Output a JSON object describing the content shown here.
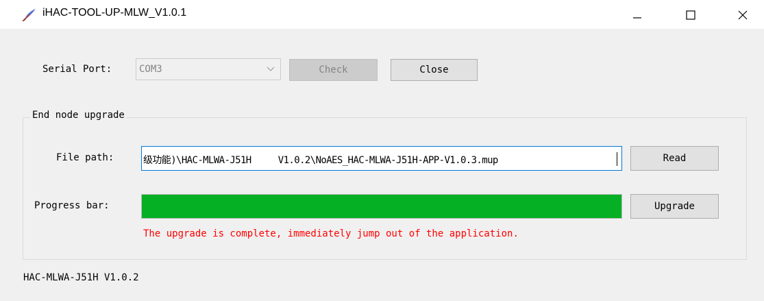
{
  "window": {
    "title": "iHAC-TOOL-UP-MLW_V1.0.1",
    "icon": "feather-pen-icon",
    "controls": {
      "minimize": "minimize-icon",
      "maximize": "maximize-icon",
      "close": "close-icon"
    }
  },
  "serial": {
    "label": "Serial Port:",
    "selected_port": "COM3",
    "check_label": "Check",
    "close_label": "Close"
  },
  "group": {
    "title": "End node upgrade",
    "file_path_label": "File path:",
    "file_path_value": "级功能)\\HAC-MLWA-J51H     V1.0.2\\NoAES_HAC-MLWA-J51H-APP-V1.0.3.mup",
    "read_label": "Read",
    "progress_label": "Progress bar:",
    "progress_fraction": 1.0,
    "upgrade_label": "Upgrade",
    "status_message": "The upgrade is complete, immediately jump out of the application."
  },
  "footer": {
    "device_version": "HAC-MLWA-J51H V1.0.2"
  },
  "colors": {
    "progress_fill": "#06b025",
    "status_text": "#ff0000",
    "input_focus_border": "#0078d7"
  }
}
